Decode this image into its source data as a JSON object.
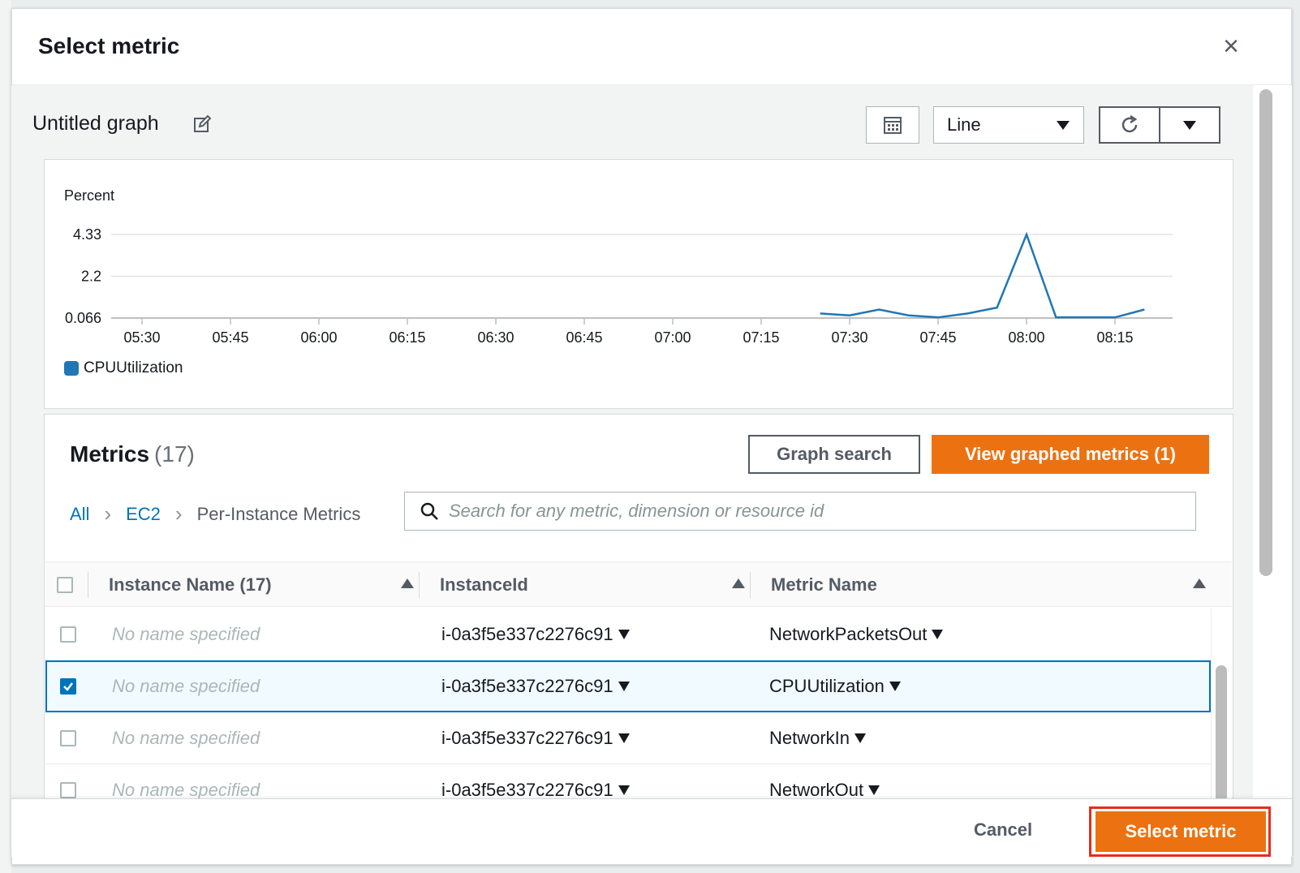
{
  "modal": {
    "title": "Select metric",
    "close_label": "×"
  },
  "graph": {
    "title": "Untitled graph",
    "type_select": "Line"
  },
  "chart_data": {
    "type": "line",
    "ylabel": "Percent",
    "yticks": [
      "4.33",
      "2.2",
      "0.066"
    ],
    "ylim": [
      0.066,
      4.33
    ],
    "xticks": [
      "05:30",
      "05:45",
      "06:00",
      "06:15",
      "06:30",
      "06:45",
      "07:00",
      "07:15",
      "07:30",
      "07:45",
      "08:00",
      "08:15"
    ],
    "series": [
      {
        "name": "CPUUtilization",
        "color": "#1f77b4",
        "x": [
          "07:25",
          "07:30",
          "07:35",
          "07:40",
          "07:45",
          "07:50",
          "07:55",
          "08:00",
          "08:05",
          "08:10",
          "08:15",
          "08:20"
        ],
        "values": [
          0.3,
          0.2,
          0.5,
          0.2,
          0.1,
          0.3,
          0.6,
          4.33,
          0.1,
          0.1,
          0.1,
          0.5
        ]
      }
    ],
    "legend": [
      "CPUUtilization"
    ]
  },
  "metrics": {
    "title": "Metrics",
    "count": "(17)",
    "graph_search": "Graph search",
    "view_graphed": "View graphed metrics (1)",
    "breadcrumb": [
      "All",
      "EC2",
      "Per-Instance Metrics"
    ],
    "search_placeholder": "Search for any metric, dimension or resource id",
    "columns": {
      "instance_name": "Instance Name  (17)",
      "instance_id": "InstanceId",
      "metric_name": "Metric Name"
    },
    "rows": [
      {
        "name": "No name specified",
        "instance_id": "i-0a3f5e337c2276c91",
        "metric": "NetworkPacketsOut",
        "checked": false
      },
      {
        "name": "No name specified",
        "instance_id": "i-0a3f5e337c2276c91",
        "metric": "CPUUtilization",
        "checked": true
      },
      {
        "name": "No name specified",
        "instance_id": "i-0a3f5e337c2276c91",
        "metric": "NetworkIn",
        "checked": false
      },
      {
        "name": "No name specified",
        "instance_id": "i-0a3f5e337c2276c91",
        "metric": "NetworkOut",
        "checked": false
      }
    ]
  },
  "footer": {
    "cancel": "Cancel",
    "select": "Select metric"
  }
}
